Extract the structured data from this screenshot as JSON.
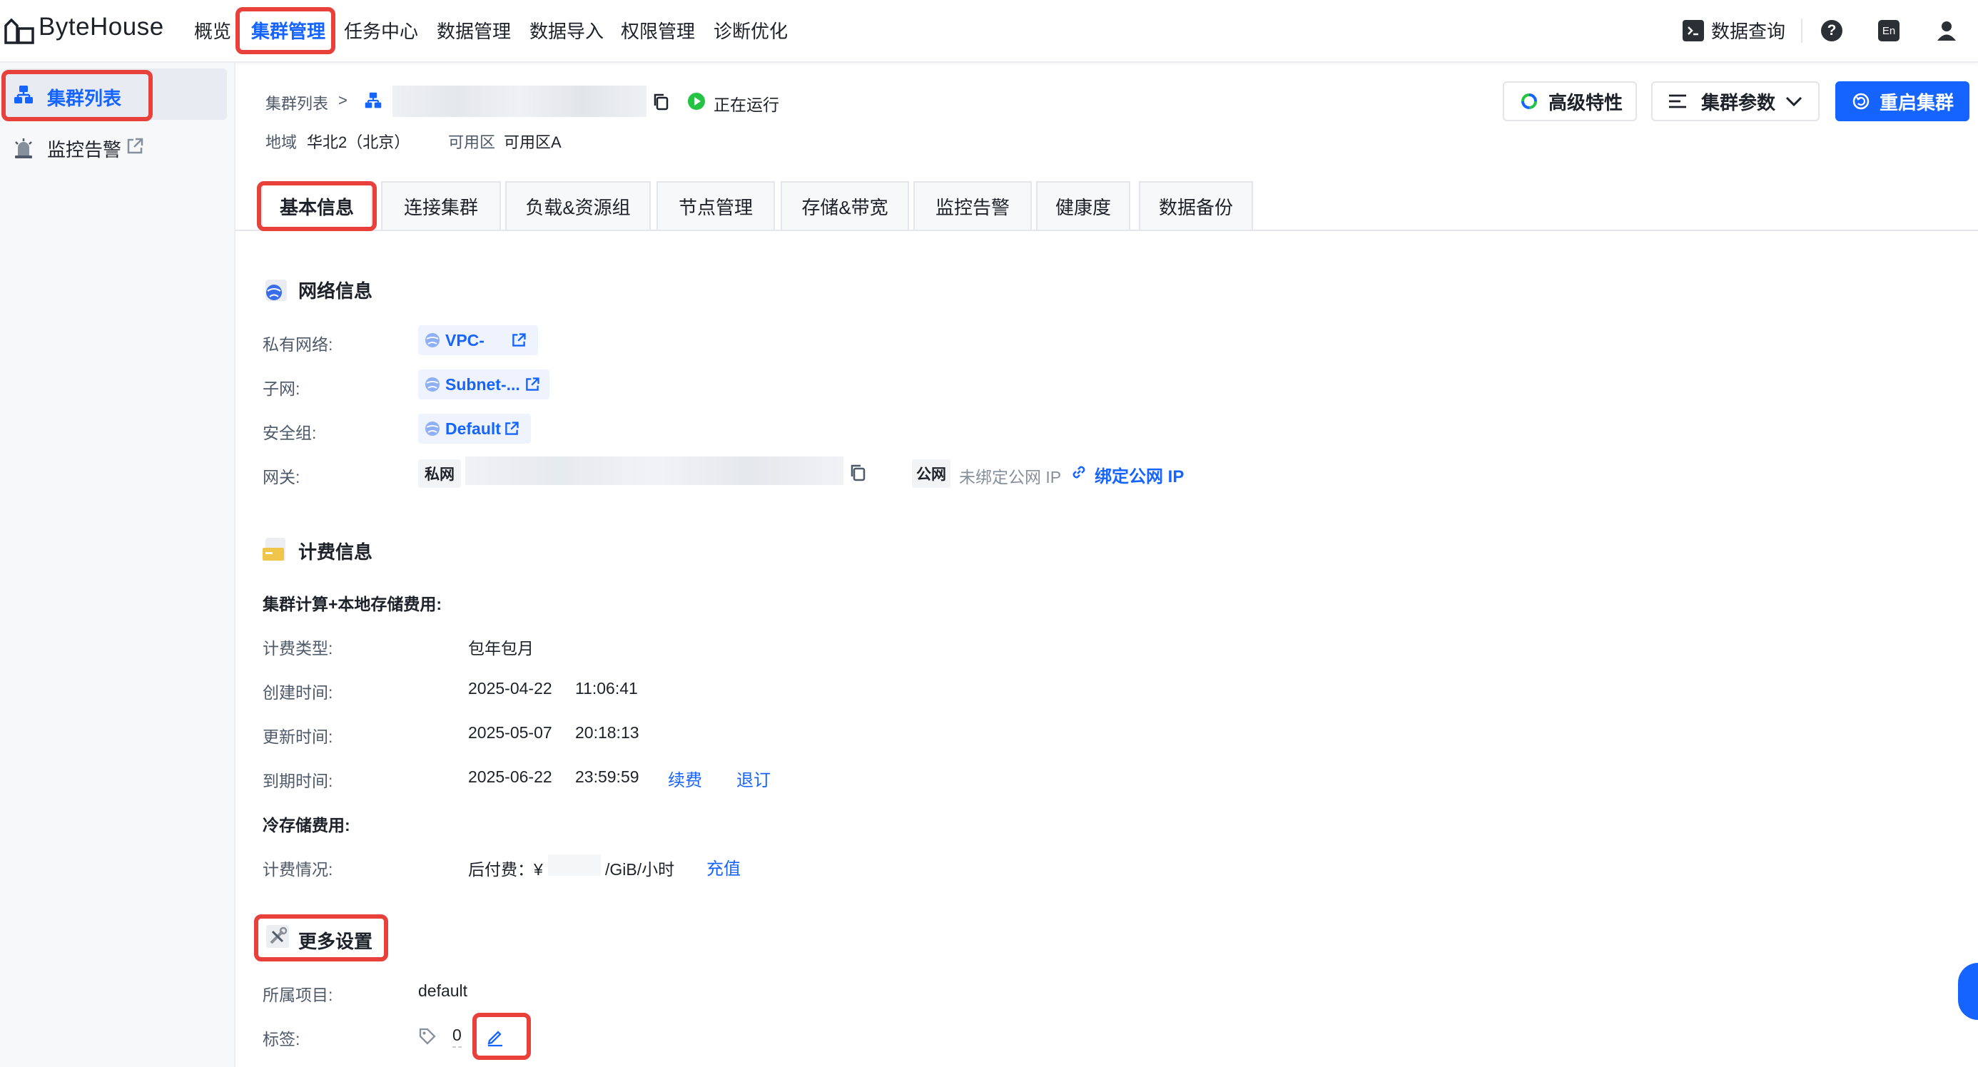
{
  "app": {
    "logo_text": "ByteHouse"
  },
  "nav": [
    "概览",
    "集群管理",
    "任务中心",
    "数据管理",
    "数据导入",
    "权限管理",
    "诊断优化"
  ],
  "nav_active": "集群管理",
  "top_right": {
    "query": "数据查询",
    "lang": "En"
  },
  "sidebar": {
    "items": [
      {
        "label": "集群列表"
      },
      {
        "label": "监控告警"
      }
    ]
  },
  "header": {
    "breadcrumb": "集群列表",
    "breadcrumb_sep": ">",
    "status": "正在运行",
    "region_label": "地域",
    "region_value": "华北2（北京）",
    "zone_label": "可用区",
    "zone_value": "可用区A",
    "btn_advanced": "高级特性",
    "btn_params": "集群参数",
    "btn_restart": "重启集群"
  },
  "tabs": [
    "基本信息",
    "连接集群",
    "负载&资源组",
    "节点管理",
    "存储&带宽",
    "监控告警",
    "健康度",
    "数据备份"
  ],
  "network": {
    "title": "网络信息",
    "vpc_label": "私有网络:",
    "vpc_value": "VPC-",
    "subnet_label": "子网:",
    "subnet_value": "Subnet-...",
    "sg_label": "安全组:",
    "sg_value": "Default",
    "gateway_label": "网关:",
    "private_tag": "私网",
    "public_tag": "公网",
    "public_unbound": "未绑定公网 IP",
    "bind_public": "绑定公网 IP"
  },
  "billing": {
    "title": "计费信息",
    "subtitle": "集群计算+本地存储费用:",
    "type_label": "计费类型:",
    "type_value": "包年包月",
    "created_label": "创建时间:",
    "created_date": "2025-04-22",
    "created_time": "11:06:41",
    "updated_label": "更新时间:",
    "updated_date": "2025-05-07",
    "updated_time": "20:18:13",
    "expire_label": "到期时间:",
    "expire_date": "2025-06-22",
    "expire_time": "23:59:59",
    "renew": "续费",
    "unsubscribe": "退订",
    "cold_title": "冷存储费用:",
    "cold_label": "计费情况:",
    "cold_prefix": "后付费：¥",
    "cold_unit": "/GiB/小时",
    "recharge": "充值"
  },
  "more": {
    "title": "更多设置",
    "project_label": "所属项目:",
    "project_value": "default",
    "tags_label": "标签:",
    "tags_count": "0"
  },
  "colors": {
    "primary": "#1664ff",
    "highlight": "#e8413b",
    "running": "#23c343"
  }
}
